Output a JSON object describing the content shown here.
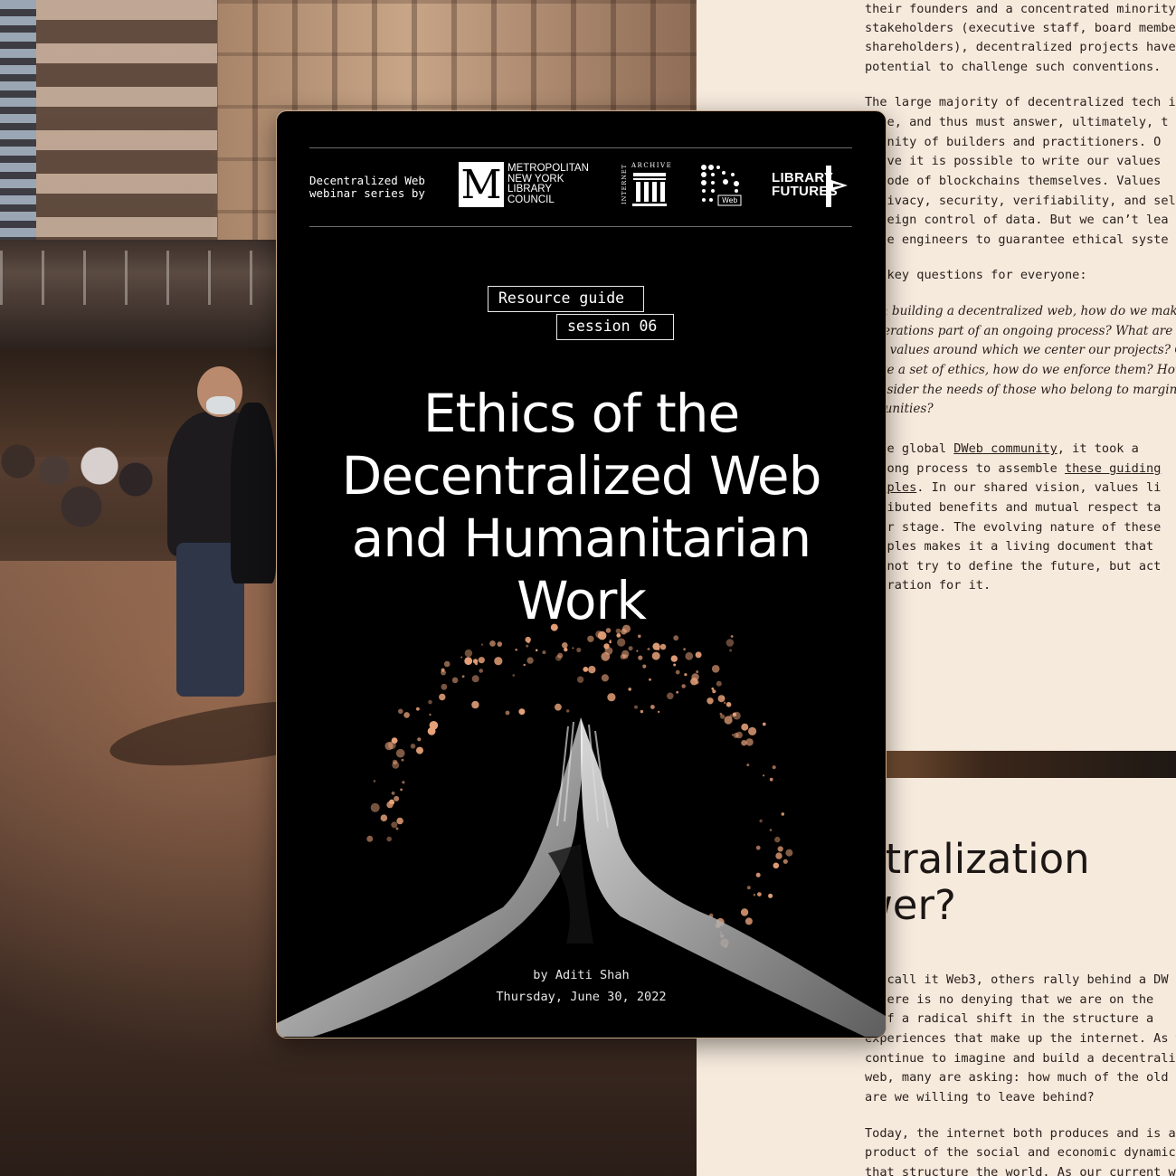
{
  "poster": {
    "series_line1": "Decentralized Web",
    "series_line2": "webinar series by",
    "partners": {
      "mnylc_letter": "M",
      "mnylc_line1": "METROPOLITAN",
      "mnylc_line2": "NEW YORK",
      "mnylc_line3": "LIBRARY COUNCIL",
      "ia_top": "ARCHIVE",
      "ia_side": "INTERNET",
      "dweb_label": "Web",
      "lf_line1": "LIBRARY",
      "lf_line2": "FUTURES"
    },
    "tag_guide": "Resource guide",
    "tag_session": "session 06",
    "title_lines": [
      "Ethics of the",
      "Decentralized Web",
      "and Humanitarian",
      "Work"
    ],
    "author": "by Aditi Shah",
    "date": "Thursday, June 30, 2022"
  },
  "document": {
    "para1": [
      "their founders and a concentrated minority",
      "stakeholders (executive staff, board member",
      "shareholders), decentralized projects have",
      "potential to challenge such conventions."
    ],
    "para2": [
      "The large majority of decentralized tech is",
      "urce, and thus must answer, ultimately, t",
      "mmunity of builders and practitioners. O",
      "lieve it is possible to write our values",
      "e code of blockchains themselves. Values",
      " privacy, security, verifiability, and sel",
      "vereign control of data. But we can’t lea",
      " the engineers to guarantee ethical syste"
    ],
    "para3": "he key questions for everyone:",
    "questions": [
      "hen building a decentralized web, how do we make",
      "siderations part of an ongoing process? What are",
      "red values around which we center our projects? O",
      "have a set of ethics, how do we enforce them? How",
      "consider the needs of those who belong to margina",
      "nmunities?"
    ],
    "para4_pre": " the global ",
    "para4_link1": "DWeb community",
    "para4_post": ", it took a",
    "para4_line2_pre": "r-long process to assemble ",
    "para4_link2": "these guiding",
    "para4_link2b": "nciples",
    "para4_line3_post": ". In our shared vision, values li",
    "para4_rest": [
      "stributed benefits and mutual respect ta",
      "ater stage. The evolving nature of these",
      "nciples makes it a living document that",
      "es not try to define the future, but act",
      "spiration for it."
    ],
    "heading_lines": [
      "ntralization",
      "wer?"
    ],
    "para5": [
      "me call it Web3, others rally behind a DW",
      " there is no denying that we are on the",
      "p of a radical shift in the structure a",
      "experiences that make up the internet. As w",
      "continue to imagine and build a decentrali",
      "web, many are asking: how much of the old",
      "are we willing to leave behind?"
    ],
    "para6": [
      "Today, the internet both produces and is a",
      "product of the social and economic dynamic",
      "that structure the world. As our current w"
    ]
  },
  "colors": {
    "page_bg": "#f6eadd",
    "card_bg": "#000000",
    "sparkle": "#e8a27a"
  }
}
